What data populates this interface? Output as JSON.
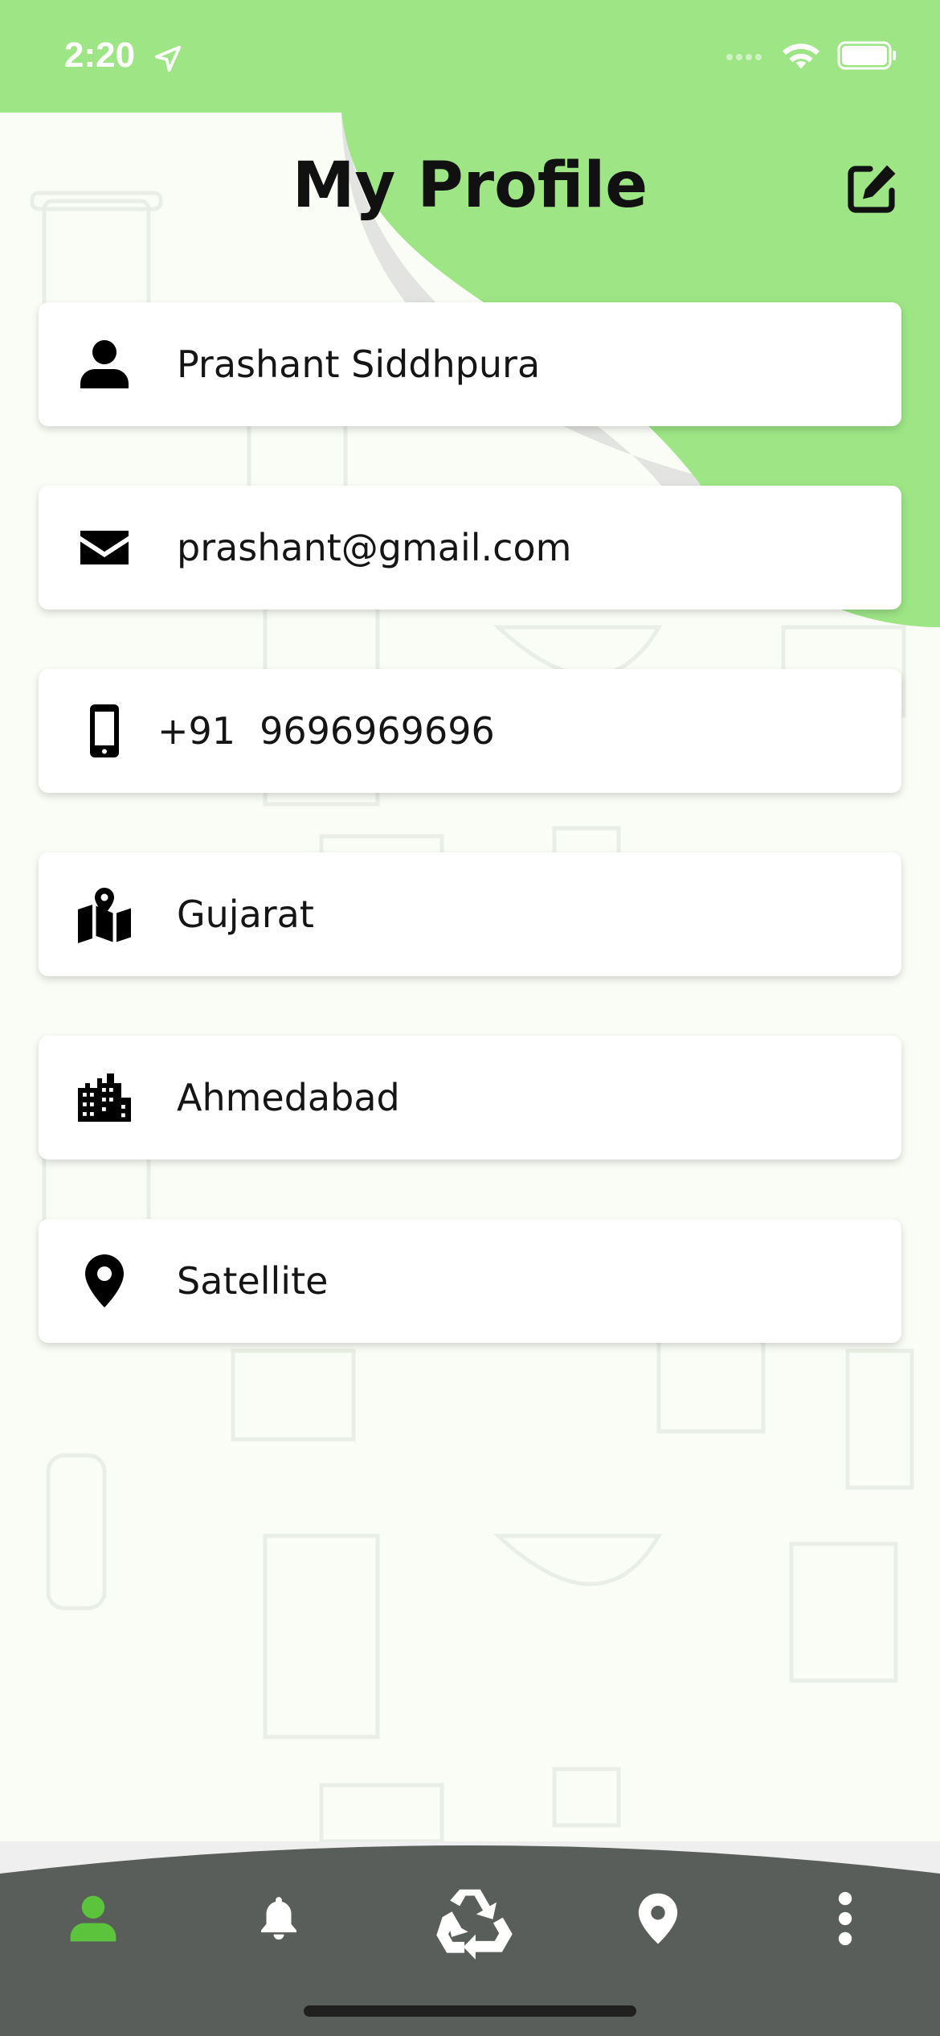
{
  "status_bar": {
    "time": "2:20"
  },
  "header": {
    "title": "My Profile"
  },
  "profile": {
    "name": "Prashant Siddhpura",
    "email": "prashant@gmail.com",
    "phone_code": "+91",
    "phone": "9696969696",
    "state": "Gujarat",
    "city": "Ahmedabad",
    "area": "Satellite"
  },
  "icons": {
    "name": "person-icon",
    "email": "envelope-icon",
    "phone": "mobile-phone-icon",
    "state": "map-icon",
    "city": "city-icon",
    "area": "map-pin-icon",
    "edit": "edit-icon"
  },
  "bottom_nav": [
    "profile-icon",
    "bell-icon",
    "recycle-icon",
    "location-icon",
    "more-icon"
  ],
  "colors": {
    "accent_green": "#9de585",
    "active_tab": "#5cc43c",
    "nav_bar": "#5a5e5a",
    "page_background": "#fafdf6"
  }
}
